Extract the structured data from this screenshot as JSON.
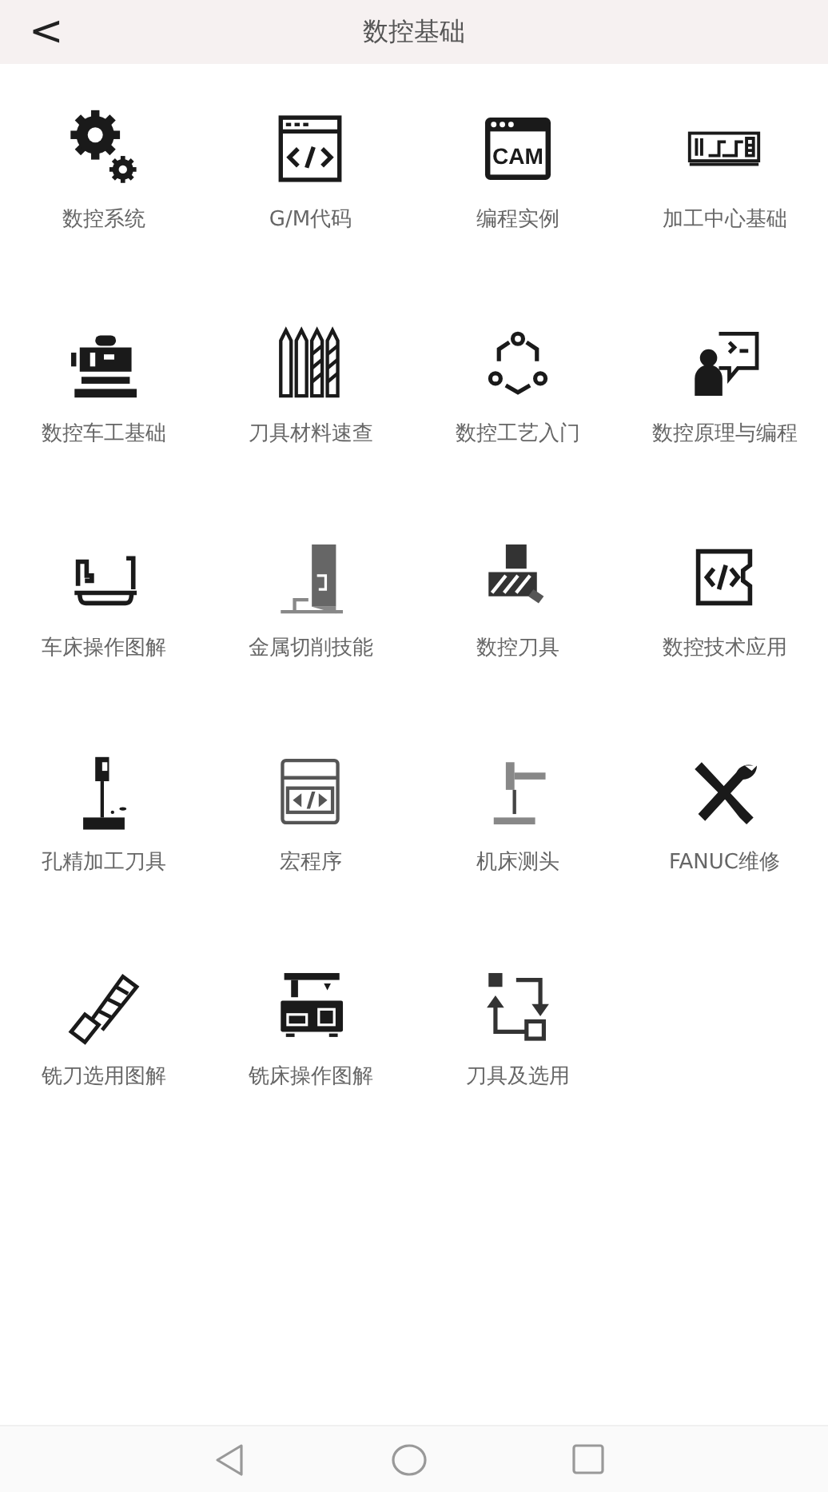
{
  "header": {
    "back": "<",
    "title": "数控基础"
  },
  "items": [
    {
      "label": "数控系统"
    },
    {
      "label": "G/M代码"
    },
    {
      "label": "编程实例"
    },
    {
      "label": "加工中心基础"
    },
    {
      "label": "数控车工基础"
    },
    {
      "label": "刀具材料速查"
    },
    {
      "label": "数控工艺入门"
    },
    {
      "label": "数控原理与编程"
    },
    {
      "label": "车床操作图解"
    },
    {
      "label": "金属切削技能"
    },
    {
      "label": "数控刀具"
    },
    {
      "label": "数控技术应用"
    },
    {
      "label": "孔精加工刀具"
    },
    {
      "label": "宏程序"
    },
    {
      "label": "机床测头"
    },
    {
      "label": "FANUC维修"
    },
    {
      "label": "铣刀选用图解"
    },
    {
      "label": "铣床操作图解"
    },
    {
      "label": "刀具及选用"
    }
  ],
  "cam_icon_text": "CAM"
}
